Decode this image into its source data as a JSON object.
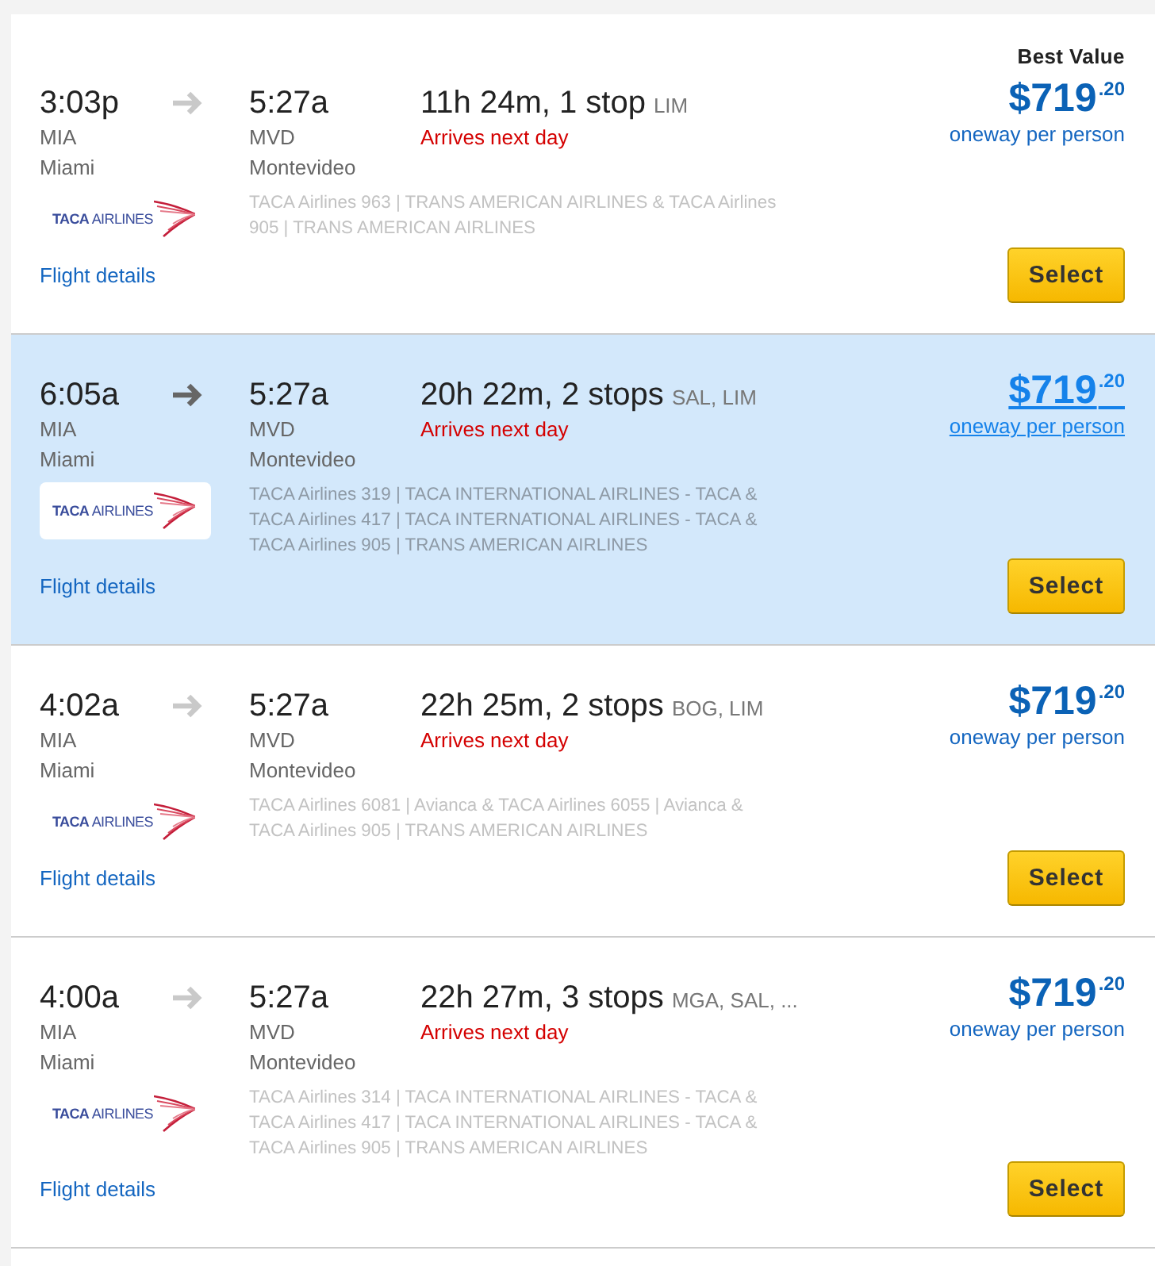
{
  "flights": [
    {
      "highlighted": false,
      "badge": "Best Value",
      "depart": {
        "time": "3:03p",
        "code": "MIA",
        "city": "Miami"
      },
      "arrive": {
        "time": "5:27a",
        "code": "MVD",
        "city": "Montevideo"
      },
      "duration": "11h 24m, 1 stop",
      "via": "LIM",
      "note": "Arrives next day",
      "airline_logo": "**TACA** AIRLINES",
      "carriers": "TACA Airlines 963 | TRANS AMERICAN AIRLINES & TACA Airlines 905 | TRANS AMERICAN AIRLINES",
      "details_link": "Flight details",
      "price": {
        "amount": "$719",
        "cents": ".20",
        "basis": "oneway per person"
      },
      "button": "Select"
    },
    {
      "highlighted": true,
      "depart": {
        "time": "6:05a",
        "code": "MIA",
        "city": "Miami"
      },
      "arrive": {
        "time": "5:27a",
        "code": "MVD",
        "city": "Montevideo"
      },
      "duration": "20h 22m, 2 stops",
      "via": "SAL, LIM",
      "note": "Arrives next day",
      "airline_logo": "**TACA** AIRLINES",
      "carriers": "TACA Airlines 319 | TACA INTERNATIONAL AIRLINES - TACA & TACA Airlines 417 | TACA INTERNATIONAL AIRLINES - TACA & TACA Airlines 905 | TRANS AMERICAN AIRLINES",
      "details_link": "Flight details",
      "price": {
        "amount": "$719",
        "cents": ".20",
        "basis": "oneway per person"
      },
      "button": "Select"
    },
    {
      "highlighted": false,
      "depart": {
        "time": "4:02a",
        "code": "MIA",
        "city": "Miami"
      },
      "arrive": {
        "time": "5:27a",
        "code": "MVD",
        "city": "Montevideo"
      },
      "duration": "22h 25m, 2 stops",
      "via": "BOG, LIM",
      "note": "Arrives next day",
      "airline_logo": "**TACA** AIRLINES",
      "carriers": "TACA Airlines 6081 | Avianca & TACA Airlines 6055 | Avianca & TACA Airlines 905 | TRANS AMERICAN AIRLINES",
      "details_link": "Flight details",
      "price": {
        "amount": "$719",
        "cents": ".20",
        "basis": "oneway per person"
      },
      "button": "Select"
    },
    {
      "highlighted": false,
      "depart": {
        "time": "4:00a",
        "code": "MIA",
        "city": "Miami"
      },
      "arrive": {
        "time": "5:27a",
        "code": "MVD",
        "city": "Montevideo"
      },
      "duration": "22h 27m, 3 stops",
      "via": "MGA, SAL, ...",
      "note": "Arrives next day",
      "airline_logo": "**TACA** AIRLINES",
      "carriers": "TACA Airlines 314 | TACA INTERNATIONAL AIRLINES - TACA & TACA Airlines 417 | TACA INTERNATIONAL AIRLINES - TACA & TACA Airlines 905 | TRANS AMERICAN AIRLINES",
      "details_link": "Flight details",
      "price": {
        "amount": "$719",
        "cents": ".20",
        "basis": "oneway per person"
      },
      "button": "Select"
    }
  ]
}
